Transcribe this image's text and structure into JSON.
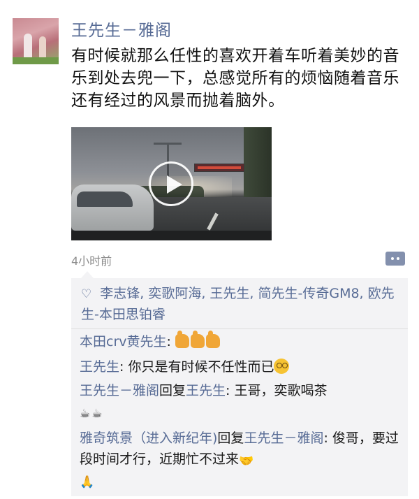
{
  "post": {
    "author": "王先生－雅阁",
    "text": "有时候就那么任性的喜欢开着车听着美妙的音乐到处去兜一下，总感觉所有的烦恼随着音乐还有经过的风景而抛着脑外。",
    "time": "4小时前"
  },
  "likes": {
    "icon": "heart-outline-icon",
    "names": "李志锋, 奕歌阿海, 王先生, 简先生-传奇GM8, 欧先生-本田思铂睿"
  },
  "comments": [
    {
      "name": "本田crv黄先生",
      "sep": ": ",
      "text": "",
      "emoji": [
        "thumbs-up-icon",
        "thumbs-up-icon",
        "thumbs-up-icon"
      ]
    },
    {
      "name": "王先生",
      "sep": ": ",
      "text": "你只是有时候不任性而已",
      "emoji": [
        "smirk-glasses-icon"
      ]
    },
    {
      "name": "王先生－雅阁",
      "reply_word": "回复",
      "reply_to": "王先生",
      "sep": ": ",
      "text": "王哥，奕歌喝茶",
      "emoji": [
        "coffee-icon",
        "coffee-icon"
      ]
    },
    {
      "name": "雅奇筑景（进入新纪年)",
      "reply_word": "回复",
      "reply_to": "王先生－雅阁",
      "sep": ": ",
      "text": "俊哥，要过段时间才行，近期忙不过来",
      "emoji": [
        "handshake-icon",
        "pray-icon"
      ]
    }
  ],
  "colors": {
    "name_link": "#576b95",
    "panel_bg": "#f3f3f5",
    "time_gray": "#8c8c8c"
  }
}
